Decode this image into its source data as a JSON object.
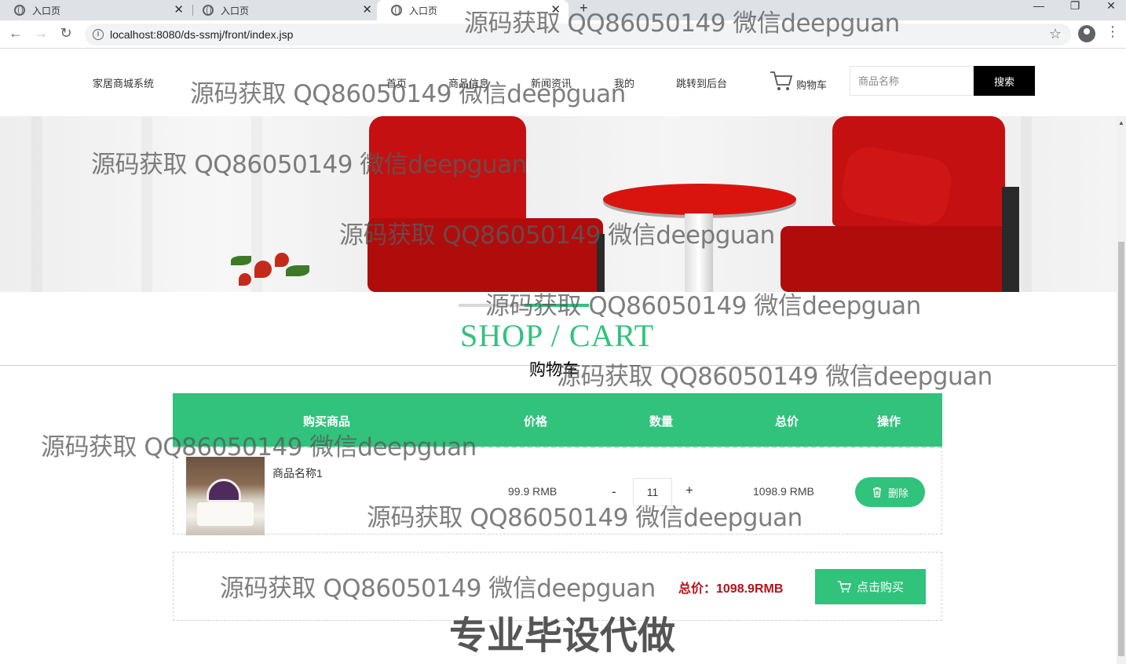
{
  "browser": {
    "tabs": [
      {
        "title": "入口页"
      },
      {
        "title": "入口页"
      },
      {
        "title": "入口页"
      }
    ],
    "url": "localhost:8080/ds-ssmj/front/index.jsp"
  },
  "header": {
    "brand": "家居商城系统",
    "nav": [
      "首页",
      "商品信息",
      "新闻资讯",
      "我的",
      "跳转到后台"
    ],
    "cart_label": "购物车",
    "search_placeholder": "商品名称",
    "search_button": "搜索"
  },
  "cart_section": {
    "title": "SHOP / CART",
    "subtitle": "购物车",
    "columns": [
      "购买商品",
      "价格",
      "数量",
      "总价",
      "操作"
    ],
    "items": [
      {
        "name": "商品名称1",
        "price": "99.9 RMB",
        "qty_minus": "-",
        "quantity": "11",
        "qty_plus": "+",
        "total": "1098.9 RMB",
        "delete_label": "删除"
      }
    ],
    "grand_total": "总价：1098.9RMB",
    "buy_label": "点击购买"
  },
  "watermarks": {
    "text": "源码获取 QQ86050149 微信deepguan",
    "big": "专业毕设代做"
  },
  "colors": {
    "accent": "#31c27c",
    "price_red": "#b4121a",
    "search_button_bg": "#000000"
  }
}
